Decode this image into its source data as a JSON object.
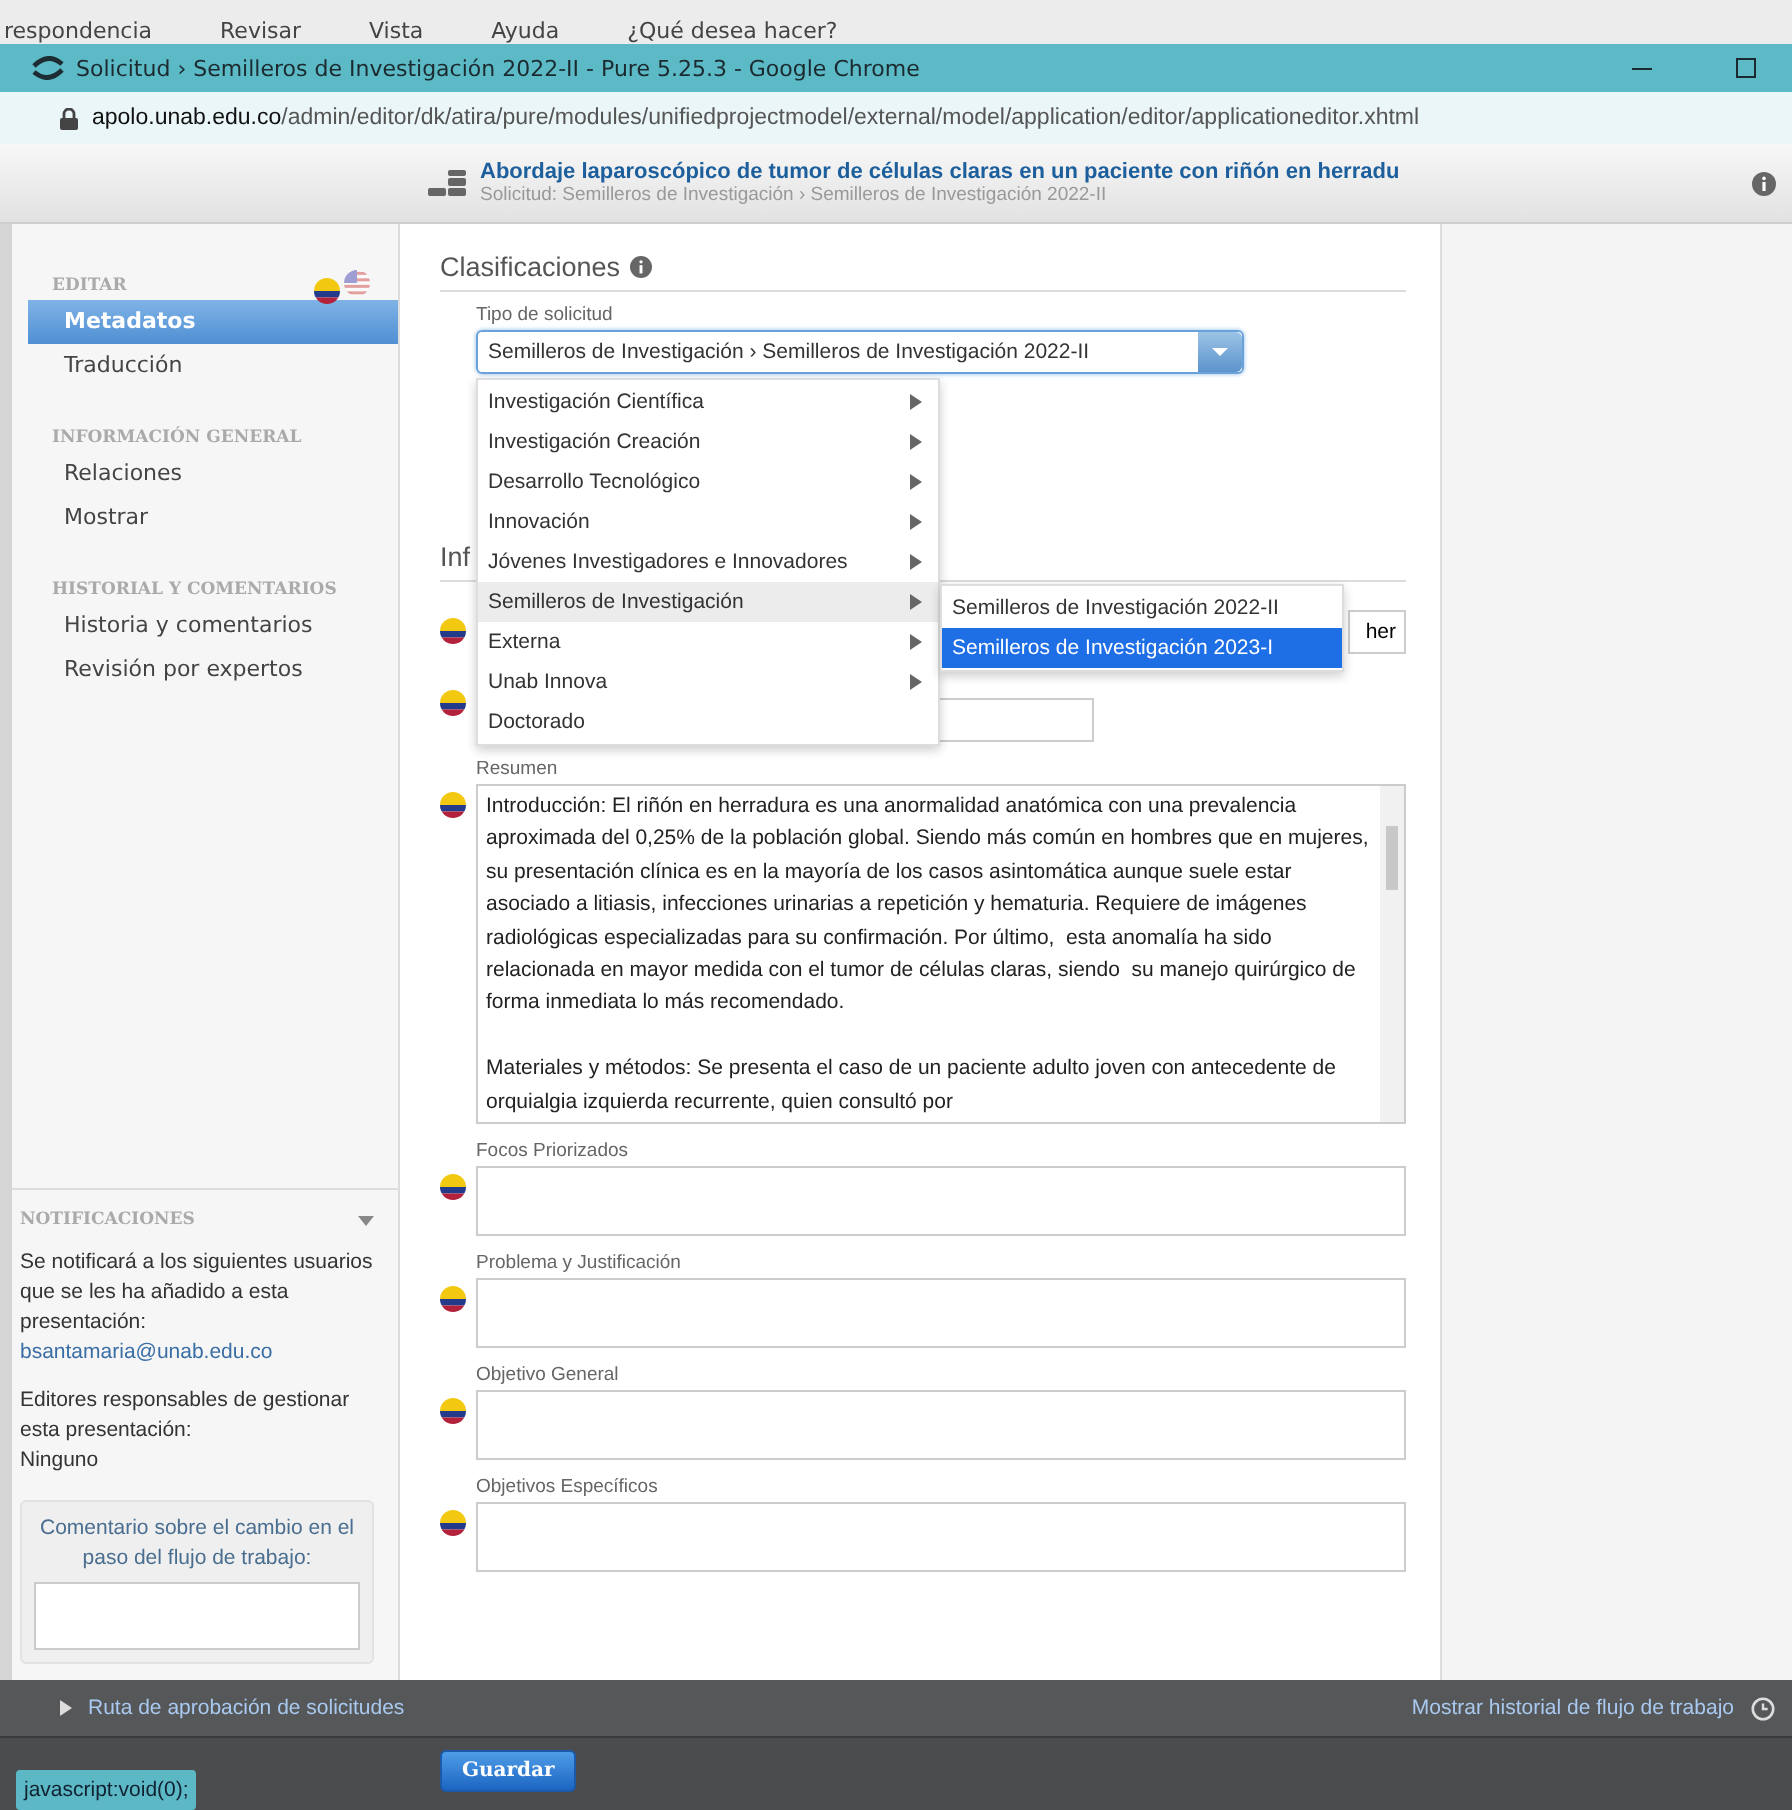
{
  "word_menu": [
    "respondencia",
    "Revisar",
    "Vista",
    "Ayuda",
    "¿Qué desea hacer?"
  ],
  "window": {
    "title": "Solicitud › Semilleros de Investigación 2022-II - Pure 5.25.3 - Google Chrome",
    "url_host": "apolo.unab.edu.co",
    "url_path": "/admin/editor/dk/atira/pure/modules/unifiedprojectmodel/external/model/application/editor/applicationeditor.xhtml"
  },
  "header": {
    "title": "Abordaje laparoscópico de tumor de células claras en un paciente con riñón en herradu",
    "breadcrumb": "Solicitud: Semilleros de Investigación › Semilleros de Investigación 2022-II"
  },
  "sidebar": {
    "sections": [
      {
        "heading": "EDITAR",
        "items": [
          {
            "label": "Metadatos",
            "selected": true
          },
          {
            "label": "Traducción",
            "selected": false
          }
        ]
      },
      {
        "heading": "INFORMACIÓN GENERAL",
        "items": [
          {
            "label": "Relaciones",
            "selected": false
          },
          {
            "label": "Mostrar",
            "selected": false
          }
        ]
      },
      {
        "heading": "HISTORIAL Y COMENTARIOS",
        "items": [
          {
            "label": "Historia y comentarios",
            "selected": false
          },
          {
            "label": "Revisión por expertos",
            "selected": false
          }
        ]
      }
    ],
    "notifications": {
      "heading": "NOTIFICACIONES",
      "text": "Se notificará a los siguientes usuarios que se les ha añadido a esta presentación:",
      "email": "bsantamaria@unab.edu.co",
      "editors_text": "Editores responsables de gestionar esta presentación:",
      "editors_value": "Ninguno",
      "comment_label": "Comentario sobre el cambio en el paso del flujo de trabajo:"
    }
  },
  "classifications": {
    "heading": "Clasificaciones",
    "label": "Tipo de solicitud",
    "value": "Semilleros de Investigación › Semilleros de Investigación 2022-II",
    "menu": [
      {
        "label": "Investigación Científica",
        "submenu": true,
        "selected": false
      },
      {
        "label": "Investigación Creación",
        "submenu": true,
        "selected": false
      },
      {
        "label": "Desarrollo Tecnológico",
        "submenu": true,
        "selected": false
      },
      {
        "label": "Innovación",
        "submenu": true,
        "selected": false
      },
      {
        "label": "Jóvenes Investigadores e Innovadores",
        "submenu": true,
        "selected": false
      },
      {
        "label": "Semilleros de Investigación",
        "submenu": true,
        "selected": true
      },
      {
        "label": "Externa",
        "submenu": true,
        "selected": false
      },
      {
        "label": "Unab Innova",
        "submenu": true,
        "selected": false
      },
      {
        "label": "Doctorado",
        "submenu": false,
        "selected": false
      }
    ],
    "submenu": [
      {
        "label": "Semilleros de Investigación 2022-II",
        "selected": false
      },
      {
        "label": "Semilleros de Investigación 2023-I",
        "selected": true
      }
    ]
  },
  "information": {
    "heading": "Inf",
    "fields": [
      {
        "kind": "text",
        "value": "her"
      },
      {
        "kind": "pair"
      },
      {
        "kind": "textarea",
        "label": "Resumen",
        "scroll": true,
        "value": "Introducción: El riñón en herradura es una anormalidad anatómica con una prevalencia aproximada del 0,25% de la población global. Siendo más común en hombres que en mujeres, su presentación clínica es en la mayoría de los casos asintomática aunque suele estar asociado a litiasis, infecciones urinarias a repetición y hematuria. Requiere de imágenes radiológicas especializadas para su confirmación. Por último,  esta anomalía ha sido relacionada en mayor medida con el tumor de células claras, siendo  su manejo quirúrgico de forma inmediata lo más recomendado.\n\nMateriales y métodos: Se presenta el caso de un paciente adulto joven con antecedente de orquialgia izquierda recurrente, quien consultó por"
      },
      {
        "kind": "textarea",
        "label": "Focos Priorizados"
      },
      {
        "kind": "textarea",
        "label": "Problema y Justificación"
      },
      {
        "kind": "textarea",
        "label": "Objetivo General"
      },
      {
        "kind": "textarea",
        "label": "Objetivos Específicos"
      }
    ]
  },
  "workflow": {
    "route": "Ruta de aprobación de solicitudes",
    "history": "Mostrar historial de flujo de trabajo"
  },
  "save_button": "Guardar",
  "status_url": "javascript:void(0);"
}
